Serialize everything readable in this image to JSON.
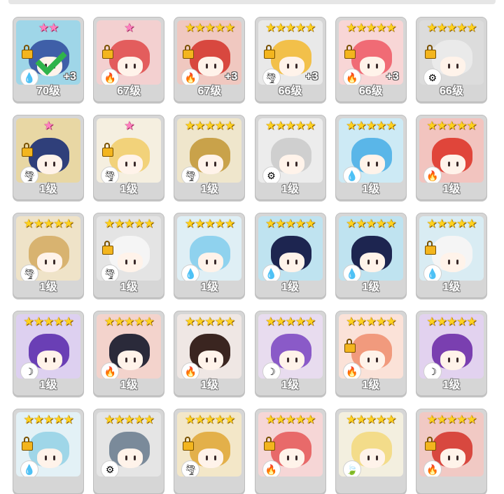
{
  "colors": {
    "star_gold": "#ffd21e",
    "star_pink": "#ff7fbf",
    "card": "#d6d6d6",
    "check": "#2fb34a"
  },
  "heroes": [
    {
      "level": "70级",
      "stars": "★★",
      "star_color": "pink",
      "element": "water",
      "plus": "+3",
      "locked": true,
      "selected": true,
      "hair": "#3f5fa8",
      "bg": "#9fd6e8"
    },
    {
      "level": "67级",
      "stars": "★",
      "star_color": "pink",
      "element": "fire",
      "plus": "",
      "locked": true,
      "selected": false,
      "hair": "#e35d5d",
      "bg": "#f3d0d0"
    },
    {
      "level": "67级",
      "stars": "★★★★★",
      "star_color": "gold",
      "element": "fire",
      "plus": "+3",
      "locked": true,
      "selected": false,
      "hair": "#d8483f",
      "bg": "#f0c8c0"
    },
    {
      "level": "66级",
      "stars": "★★★★★",
      "star_color": "gold",
      "element": "wind",
      "plus": "+3",
      "locked": true,
      "selected": false,
      "hair": "#f2c04a",
      "bg": "#e9e9e9"
    },
    {
      "level": "66级",
      "stars": "★★★★★",
      "star_color": "gold",
      "element": "fire",
      "plus": "+3",
      "locked": true,
      "selected": false,
      "hair": "#f06b75",
      "bg": "#f8d6d6"
    },
    {
      "level": "66级",
      "stars": "★★★★★",
      "star_color": "gold",
      "element": "light",
      "plus": "",
      "locked": true,
      "selected": false,
      "hair": "#eaeaea",
      "bg": "#dcdcdc"
    },
    {
      "level": "1级",
      "stars": "★",
      "star_color": "pink",
      "element": "wind",
      "plus": "",
      "locked": true,
      "selected": false,
      "hair": "#2f3f7a",
      "bg": "#e8d7a4"
    },
    {
      "level": "1级",
      "stars": "★",
      "star_color": "pink",
      "element": "wind",
      "plus": "",
      "locked": true,
      "selected": false,
      "hair": "#f2d27a",
      "bg": "#f5efe0"
    },
    {
      "level": "1级",
      "stars": "★★★★★",
      "star_color": "gold",
      "element": "wind",
      "plus": "",
      "locked": false,
      "selected": false,
      "hair": "#c9a24a",
      "bg": "#efe6cc"
    },
    {
      "level": "1级",
      "stars": "★★★★★",
      "star_color": "gold",
      "element": "light",
      "plus": "",
      "locked": false,
      "selected": false,
      "hair": "#cfcfcf",
      "bg": "#ececec"
    },
    {
      "level": "1级",
      "stars": "★★★★★",
      "star_color": "gold",
      "element": "water",
      "plus": "",
      "locked": false,
      "selected": false,
      "hair": "#5ab6e8",
      "bg": "#cdeaf5"
    },
    {
      "level": "1级",
      "stars": "★★★★★",
      "star_color": "gold",
      "element": "fire",
      "plus": "",
      "locked": false,
      "selected": false,
      "hair": "#e0453a",
      "bg": "#f2c4bf"
    },
    {
      "level": "1级",
      "stars": "★★★★★",
      "star_color": "gold",
      "element": "wind",
      "plus": "",
      "locked": false,
      "selected": false,
      "hair": "#d8b370",
      "bg": "#efe3c8"
    },
    {
      "level": "1级",
      "stars": "★★★★★",
      "star_color": "gold",
      "element": "wind",
      "plus": "",
      "locked": true,
      "selected": false,
      "hair": "#f5f5f5",
      "bg": "#e4e4e4"
    },
    {
      "level": "1级",
      "stars": "★★★★★",
      "star_color": "gold",
      "element": "water",
      "plus": "",
      "locked": false,
      "selected": false,
      "hair": "#8fd2ee",
      "bg": "#dfeff5"
    },
    {
      "level": "1级",
      "stars": "★★★★★",
      "star_color": "gold",
      "element": "water",
      "plus": "",
      "locked": false,
      "selected": false,
      "hair": "#1d2550",
      "bg": "#bfe3f0"
    },
    {
      "level": "1级",
      "stars": "★★★★★",
      "star_color": "gold",
      "element": "water",
      "plus": "",
      "locked": false,
      "selected": false,
      "hair": "#1d2550",
      "bg": "#bfe3f0"
    },
    {
      "level": "1级",
      "stars": "★★★★★",
      "star_color": "gold",
      "element": "water",
      "plus": "",
      "locked": true,
      "selected": false,
      "hair": "#f5f5f5",
      "bg": "#d9ecf3"
    },
    {
      "level": "1级",
      "stars": "★★★★★",
      "star_color": "gold",
      "element": "dark",
      "plus": "",
      "locked": false,
      "selected": false,
      "hair": "#6a3fb5",
      "bg": "#ddd0f0"
    },
    {
      "level": "1级",
      "stars": "★★★★★",
      "star_color": "gold",
      "element": "fire",
      "plus": "",
      "locked": false,
      "selected": false,
      "hair": "#2a2a3a",
      "bg": "#f3d3cc"
    },
    {
      "level": "1级",
      "stars": "★★★★★",
      "star_color": "gold",
      "element": "fire",
      "plus": "",
      "locked": false,
      "selected": false,
      "hair": "#3a2520",
      "bg": "#efe7e4"
    },
    {
      "level": "1级",
      "stars": "★★★★★",
      "star_color": "gold",
      "element": "dark",
      "plus": "",
      "locked": false,
      "selected": false,
      "hair": "#8a5ac8",
      "bg": "#e8dcef"
    },
    {
      "level": "1级",
      "stars": "★★★★★",
      "star_color": "gold",
      "element": "fire",
      "plus": "",
      "locked": true,
      "selected": false,
      "hair": "#f19a7d",
      "bg": "#fbe2d8"
    },
    {
      "level": "1级",
      "stars": "★★★★★",
      "star_color": "gold",
      "element": "dark",
      "plus": "",
      "locked": false,
      "selected": false,
      "hair": "#7a3fb0",
      "bg": "#e2d2ef"
    },
    {
      "level": "",
      "stars": "★★★★★",
      "star_color": "gold",
      "element": "water",
      "plus": "",
      "locked": true,
      "selected": false,
      "hair": "#9fd6e8",
      "bg": "#e3f1f6"
    },
    {
      "level": "",
      "stars": "★★★★★",
      "star_color": "gold",
      "element": "light",
      "plus": "",
      "locked": false,
      "selected": false,
      "hair": "#7a8a9a",
      "bg": "#e5e5e5"
    },
    {
      "level": "",
      "stars": "★★★★★",
      "star_color": "gold",
      "element": "wind",
      "plus": "",
      "locked": true,
      "selected": false,
      "hair": "#e3b04a",
      "bg": "#f3e7c8"
    },
    {
      "level": "",
      "stars": "★★★★★",
      "star_color": "gold",
      "element": "fire",
      "plus": "",
      "locked": true,
      "selected": false,
      "hair": "#e86a6a",
      "bg": "#f6d6d6"
    },
    {
      "level": "",
      "stars": "★★★★★",
      "star_color": "gold",
      "element": "nature",
      "plus": "",
      "locked": false,
      "selected": false,
      "hair": "#f3dc8a",
      "bg": "#f3efdf"
    },
    {
      "level": "",
      "stars": "★★★★★",
      "star_color": "gold",
      "element": "fire",
      "plus": "",
      "locked": true,
      "selected": false,
      "hair": "#d8483f",
      "bg": "#f1c9c4"
    }
  ],
  "element_icons": {
    "water": "💧",
    "fire": "🔥",
    "wind": "🌪",
    "light": "⚙",
    "dark": "☽",
    "nature": "🍃"
  }
}
